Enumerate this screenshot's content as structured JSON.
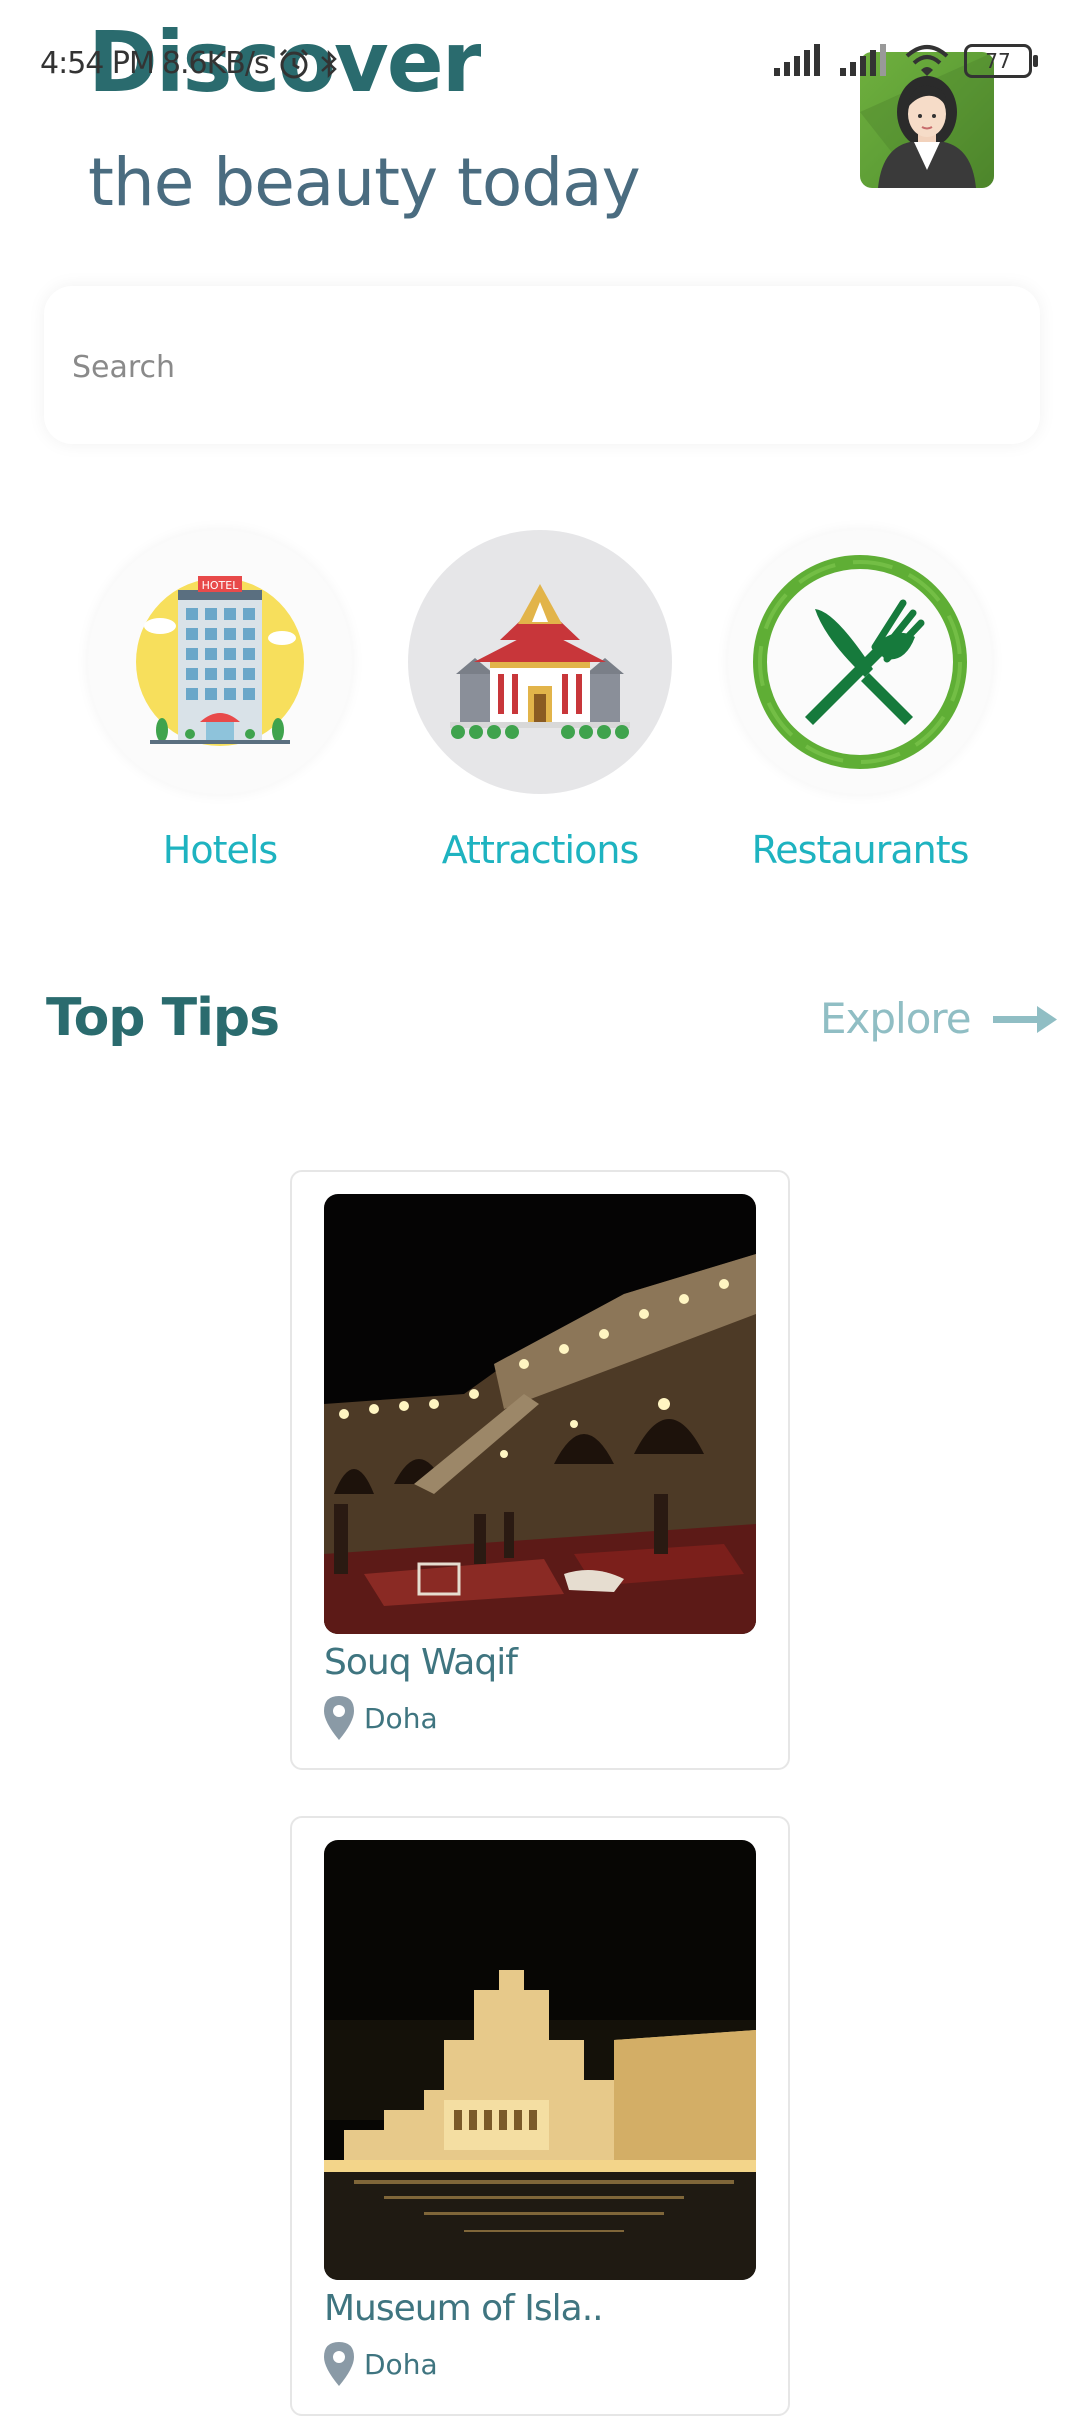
{
  "status_bar": {
    "time": "4:54 PM",
    "speed": "8.6KB/s",
    "battery": "77"
  },
  "header": {
    "title": "Discover",
    "subtitle": "the beauty today"
  },
  "search": {
    "placeholder": "Search"
  },
  "categories": [
    {
      "label": "Hotels",
      "icon": "hotel-icon"
    },
    {
      "label": "Attractions",
      "icon": "temple-icon"
    },
    {
      "label": "Restaurants",
      "icon": "fork-knife-icon"
    }
  ],
  "top_tips": {
    "title": "Top Tips",
    "explore_label": "Explore",
    "cards": [
      {
        "title": "Souq Waqif",
        "location": "Doha"
      },
      {
        "title": "Museum of Isla..",
        "location": "Doha"
      }
    ]
  },
  "colors": {
    "accent": "#1eb3c0",
    "heading": "#2a6b6e",
    "subtitle": "#4a6c80",
    "explore": "#90bec4"
  }
}
